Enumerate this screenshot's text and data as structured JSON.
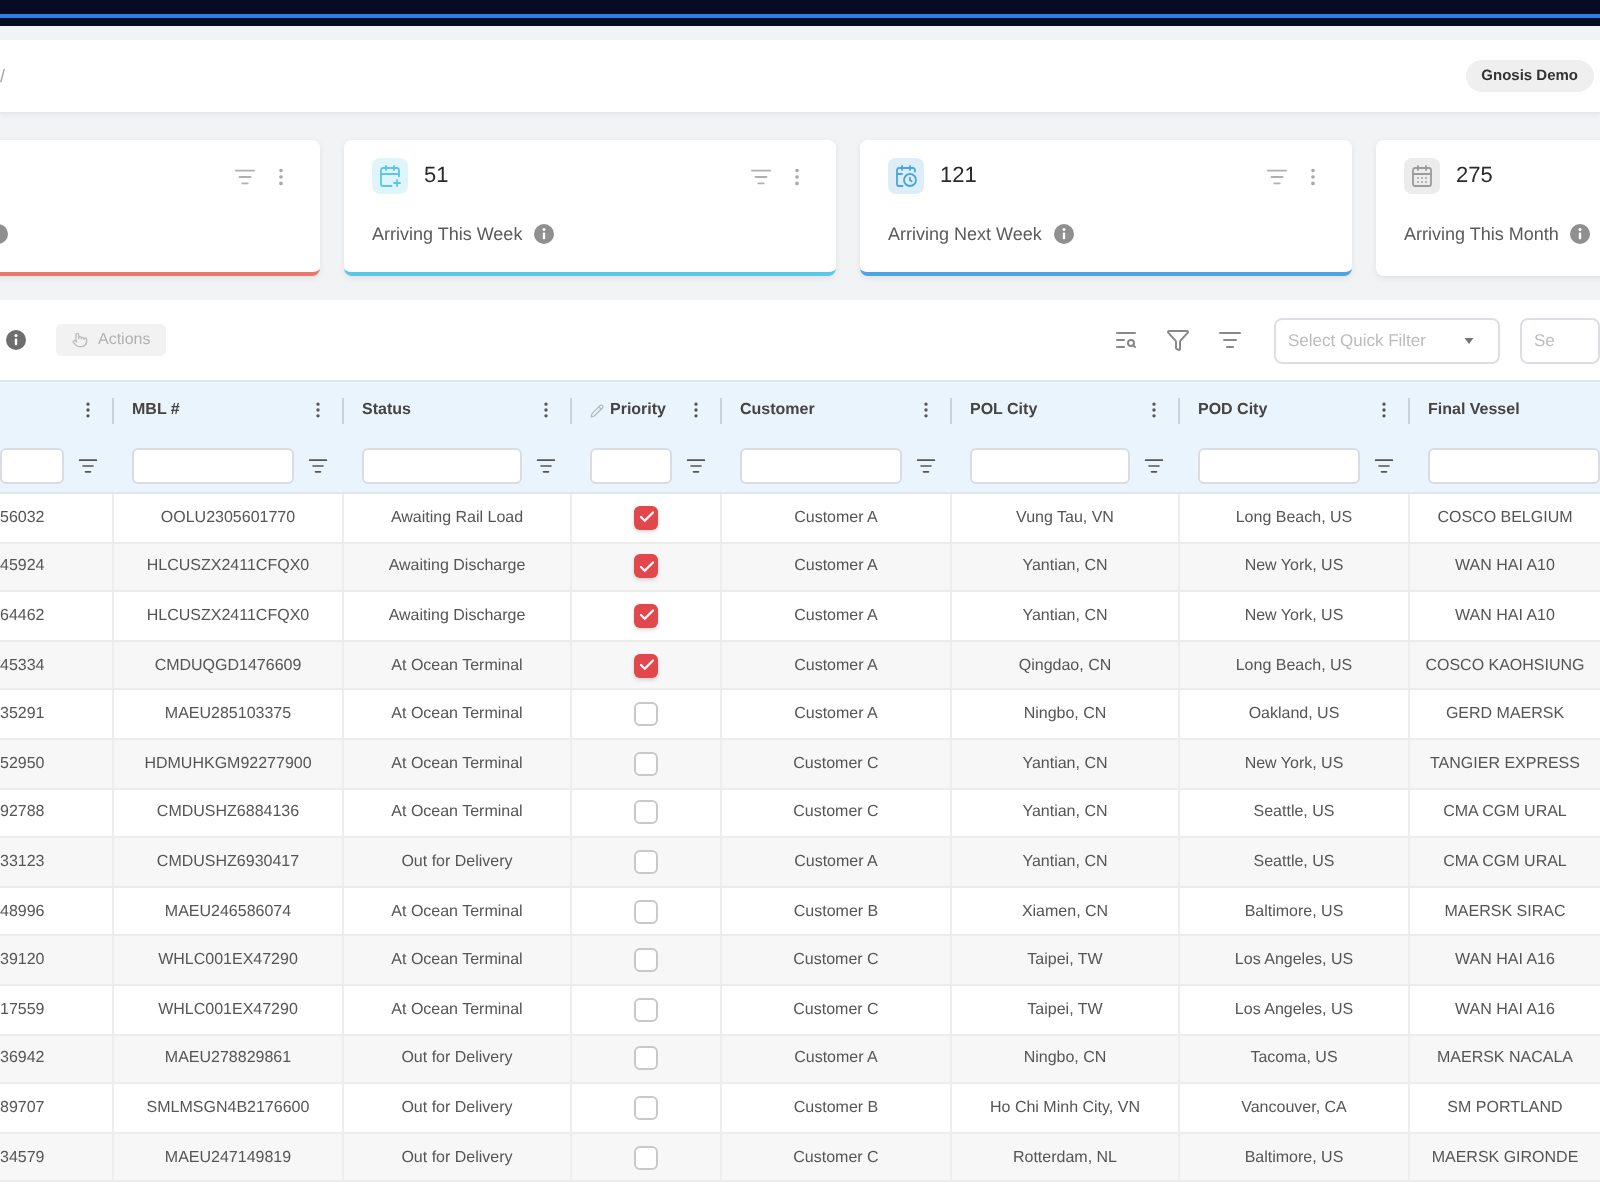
{
  "header": {
    "breadcrumb": "/",
    "user_badge": "Gnosis Demo"
  },
  "cards": [
    {
      "color": "#e8776e"
    },
    {
      "count": "51",
      "label": "Arriving This Week",
      "color": "#5ac8e4"
    },
    {
      "count": "121",
      "label": "Arriving Next Week",
      "color": "#4aa5e0"
    },
    {
      "count": "275",
      "label": "Arriving This Month"
    }
  ],
  "toolbar": {
    "actions": {
      "label": "Actions",
      "disabled": true
    },
    "quick_filter": {
      "placeholder": "Select Quick Filter"
    },
    "search": {
      "placeholder": "Se"
    }
  },
  "table": {
    "columns": [
      {
        "kind": "text"
      },
      {
        "kind": "text",
        "label": "MBL #",
        "editable": false
      },
      {
        "kind": "text",
        "label": "Status",
        "editable": false
      },
      {
        "kind": "checkbox",
        "label": "Priority",
        "editable": true
      },
      {
        "kind": "text",
        "label": "Customer",
        "editable": false
      },
      {
        "kind": "text",
        "label": "POL City",
        "editable": false
      },
      {
        "kind": "text",
        "label": "POD City",
        "editable": false
      },
      {
        "kind": "text",
        "label": "Final Vessel",
        "editable": false
      }
    ],
    "rows": [
      {
        "cells": [
          "56032",
          "OOLU2305601770",
          "Awaiting Rail Load",
          {
            "checked": true
          },
          "Customer A",
          "Vung Tau, VN",
          "Long Beach, US",
          "COSCO BELGIUM"
        ]
      },
      {
        "cells": [
          "45924",
          "HLCUSZX2411CFQX0",
          "Awaiting Discharge",
          {
            "checked": true
          },
          "Customer A",
          "Yantian, CN",
          "New York, US",
          "WAN HAI A10"
        ]
      },
      {
        "cells": [
          "64462",
          "HLCUSZX2411CFQX0",
          "Awaiting Discharge",
          {
            "checked": true
          },
          "Customer A",
          "Yantian, CN",
          "New York, US",
          "WAN HAI A10"
        ]
      },
      {
        "cells": [
          "45334",
          "CMDUQGD1476609",
          "At Ocean Terminal",
          {
            "checked": true
          },
          "Customer A",
          "Qingdao, CN",
          "Long Beach, US",
          "COSCO KAOHSIUNG"
        ]
      },
      {
        "cells": [
          "35291",
          "MAEU285103375",
          "At Ocean Terminal",
          {
            "checked": false
          },
          "Customer A",
          "Ningbo, CN",
          "Oakland, US",
          "GERD MAERSK"
        ]
      },
      {
        "cells": [
          "52950",
          "HDMUHKGM92277900",
          "At Ocean Terminal",
          {
            "checked": false
          },
          "Customer C",
          "Yantian, CN",
          "New York, US",
          "TANGIER EXPRESS"
        ]
      },
      {
        "cells": [
          "92788",
          "CMDUSHZ6884136",
          "At Ocean Terminal",
          {
            "checked": false
          },
          "Customer C",
          "Yantian, CN",
          "Seattle, US",
          "CMA CGM URAL"
        ]
      },
      {
        "cells": [
          "33123",
          "CMDUSHZ6930417",
          "Out for Delivery",
          {
            "checked": false
          },
          "Customer A",
          "Yantian, CN",
          "Seattle, US",
          "CMA CGM URAL"
        ]
      },
      {
        "cells": [
          "48996",
          "MAEU246586074",
          "At Ocean Terminal",
          {
            "checked": false
          },
          "Customer B",
          "Xiamen, CN",
          "Baltimore, US",
          "MAERSK SIRAC"
        ]
      },
      {
        "cells": [
          "39120",
          "WHLC001EX47290",
          "At Ocean Terminal",
          {
            "checked": false
          },
          "Customer C",
          "Taipei, TW",
          "Los Angeles, US",
          "WAN HAI A16"
        ]
      },
      {
        "cells": [
          "17559",
          "WHLC001EX47290",
          "At Ocean Terminal",
          {
            "checked": false
          },
          "Customer C",
          "Taipei, TW",
          "Los Angeles, US",
          "WAN HAI A16"
        ]
      },
      {
        "cells": [
          "36942",
          "MAEU278829861",
          "Out for Delivery",
          {
            "checked": false
          },
          "Customer A",
          "Ningbo, CN",
          "Tacoma, US",
          "MAERSK NACALA"
        ]
      },
      {
        "cells": [
          "89707",
          "SMLMSGN4B2176600",
          "Out for Delivery",
          {
            "checked": false
          },
          "Customer B",
          "Ho Chi Minh City, VN",
          "Vancouver, CA",
          "SM PORTLAND"
        ]
      },
      {
        "cells": [
          "34579",
          "MAEU247149819",
          "Out for Delivery",
          {
            "checked": false
          },
          "Customer C",
          "Rotterdam, NL",
          "Baltimore, US",
          "MAERSK GIRONDE"
        ]
      }
    ]
  }
}
